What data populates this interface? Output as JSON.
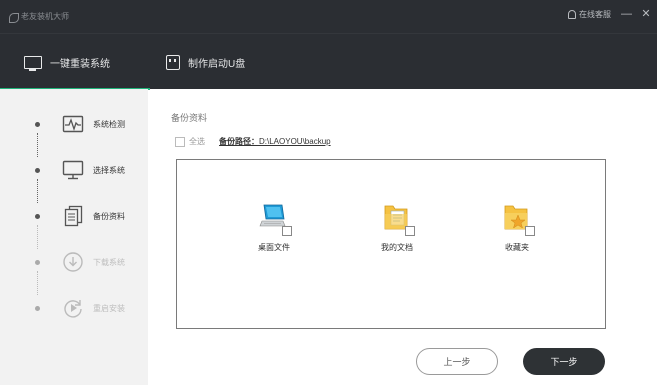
{
  "titlebar": {
    "app_title": "老友装机大师",
    "support_label": "在线客服",
    "minimize_label": "—",
    "close_label": "✕"
  },
  "nav": {
    "tabs": [
      {
        "label": "一键重装系统",
        "icon": "monitor-icon",
        "active": true
      },
      {
        "label": "制作启动U盘",
        "icon": "usb-drive-icon",
        "active": false
      }
    ]
  },
  "sidebar": {
    "steps": [
      {
        "label": "系统检测",
        "icon": "pulse-icon",
        "enabled": true
      },
      {
        "label": "选择系统",
        "icon": "monitor-icon",
        "enabled": true
      },
      {
        "label": "备份资料",
        "icon": "documents-icon",
        "enabled": true
      },
      {
        "label": "下载系统",
        "icon": "download-icon",
        "enabled": false
      },
      {
        "label": "重启安装",
        "icon": "restart-icon",
        "enabled": false
      }
    ]
  },
  "main": {
    "section_title": "备份资料",
    "select_all_label": "全选",
    "backup_path_label": "备份路径：",
    "backup_path_value": "D:\\LAOYOU\\backup",
    "files": [
      {
        "label": "桌面文件",
        "icon": "desktop-computer-icon",
        "checked": false
      },
      {
        "label": "我的文档",
        "icon": "documents-folder-icon",
        "checked": false
      },
      {
        "label": "收藏夹",
        "icon": "favorites-folder-icon",
        "checked": false
      }
    ]
  },
  "buttons": {
    "prev_label": "上一步",
    "next_label": "下一步"
  },
  "colors": {
    "header_bg": "#2b2e33",
    "accent_green": "#1fb37a",
    "sidebar_bg": "#f2f2f2",
    "primary_button": "#2e3235"
  }
}
